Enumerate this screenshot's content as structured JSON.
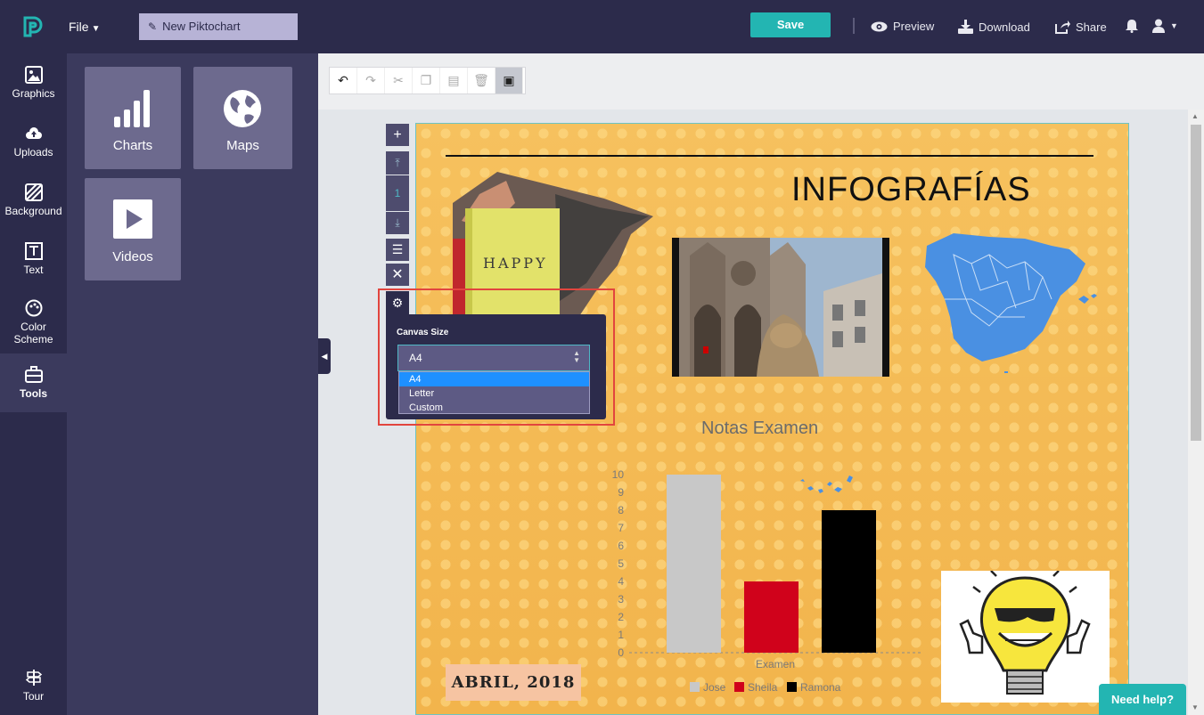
{
  "header": {
    "file_label": "File",
    "title_value": "New Piktochart",
    "save_label": "Save",
    "preview_label": "Preview",
    "download_label": "Download",
    "share_label": "Share"
  },
  "nav": {
    "items": [
      {
        "label": "Graphics",
        "icon": "image-icon"
      },
      {
        "label": "Uploads",
        "icon": "cloud-upload-icon"
      },
      {
        "label": "Background",
        "icon": "background-icon"
      },
      {
        "label": "Text",
        "icon": "text-icon"
      },
      {
        "label": "Color Scheme",
        "icon": "palette-icon"
      },
      {
        "label": "Tools",
        "icon": "toolbox-icon",
        "active": true
      }
    ],
    "tour_label": "Tour"
  },
  "tools_panel": {
    "tiles": [
      {
        "label": "Charts",
        "icon": "bar-chart-icon"
      },
      {
        "label": "Maps",
        "icon": "globe-icon"
      },
      {
        "label": "Videos",
        "icon": "play-icon"
      }
    ]
  },
  "page_controls": {
    "page_number": "1"
  },
  "canvas_settings": {
    "label": "Canvas Size",
    "selected": "A4",
    "options": [
      "A4",
      "Letter",
      "Custom"
    ]
  },
  "infographic": {
    "title": "INFOGRAFÍAS",
    "book_text": "HAPPY",
    "date_text": "ABRIL, 2018"
  },
  "chart_data": {
    "type": "bar",
    "title": "Notas Examen",
    "xlabel": "Examen",
    "ylabel": "",
    "categories": [
      "Examen"
    ],
    "series": [
      {
        "name": "Jose",
        "values": [
          10
        ],
        "color": "#c8c8c8"
      },
      {
        "name": "Sheila",
        "values": [
          4
        ],
        "color": "#d0021b"
      },
      {
        "name": "Ramona",
        "values": [
          8
        ],
        "color": "#000000"
      }
    ],
    "ylim": [
      0,
      10
    ],
    "yticks": [
      "0",
      "1",
      "2",
      "3",
      "4",
      "5",
      "6",
      "7",
      "8",
      "9",
      "10"
    ],
    "legend": "bottom"
  },
  "help_label": "Need help?",
  "colors": {
    "accent": "#23b5b2",
    "nav_bg": "#2c2b4b",
    "panel_bg": "#3b3a5d",
    "canvas_bg": "#f6c15e"
  }
}
